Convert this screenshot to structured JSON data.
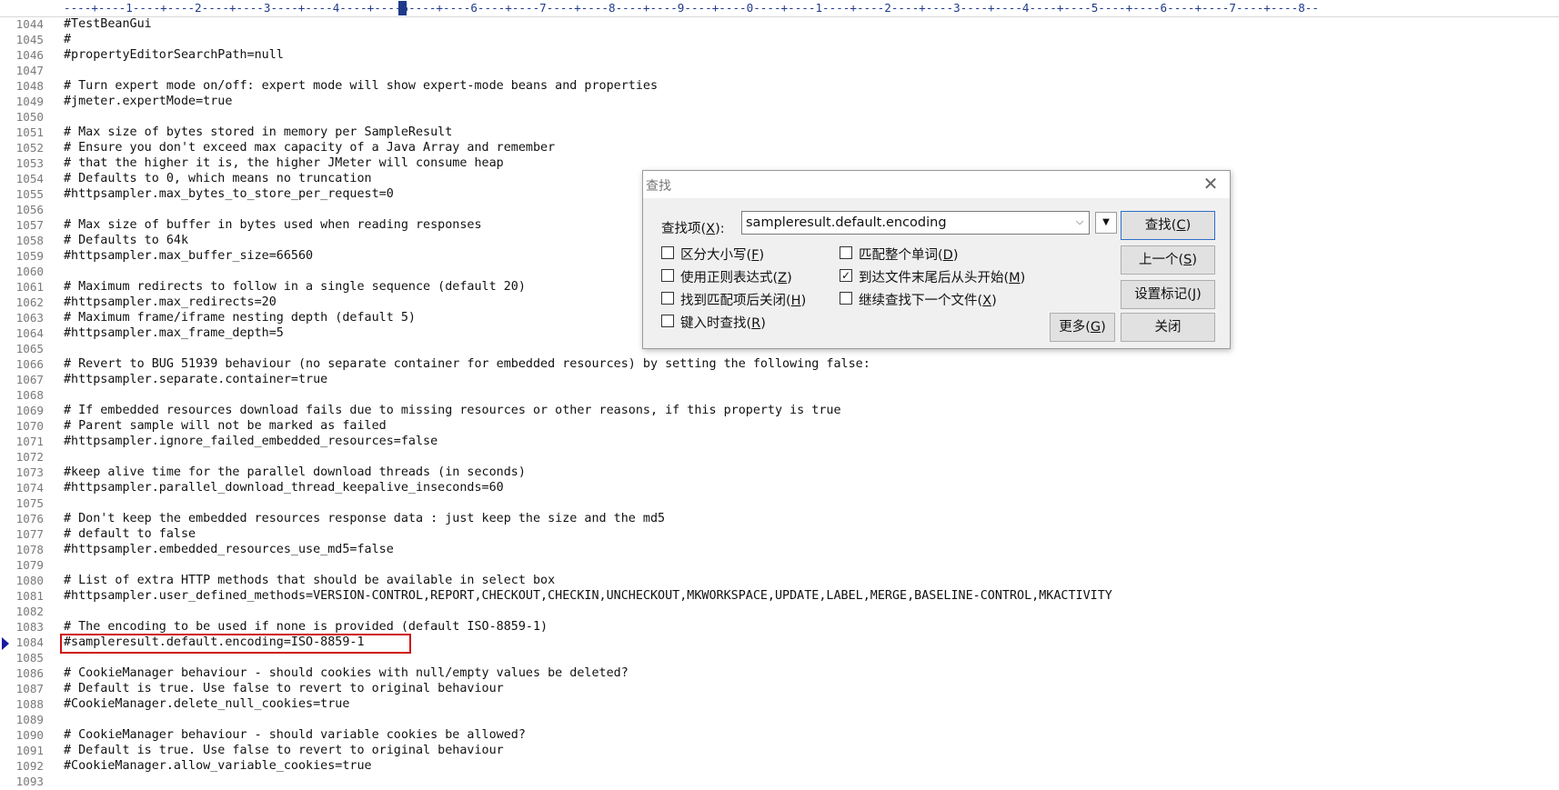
{
  "ruler": {
    "text": "----+----1----+----2----+----3----+----4----+----5----+----6----+----7----+----8----+----9----+----0----+----1----+----2----+----3----+----4----+----5----+----6----+----7----+----8--"
  },
  "editor": {
    "lines": [
      {
        "num": "1044",
        "text": "#TestBeanGui"
      },
      {
        "num": "1045",
        "text": "#"
      },
      {
        "num": "1046",
        "text": "#propertyEditorSearchPath=null"
      },
      {
        "num": "1047",
        "text": ""
      },
      {
        "num": "1048",
        "text": "# Turn expert mode on/off: expert mode will show expert-mode beans and properties"
      },
      {
        "num": "1049",
        "text": "#jmeter.expertMode=true"
      },
      {
        "num": "1050",
        "text": ""
      },
      {
        "num": "1051",
        "text": "# Max size of bytes stored in memory per SampleResult"
      },
      {
        "num": "1052",
        "text": "# Ensure you don't exceed max capacity of a Java Array and remember"
      },
      {
        "num": "1053",
        "text": "# that the higher it is, the higher JMeter will consume heap"
      },
      {
        "num": "1054",
        "text": "# Defaults to 0, which means no truncation"
      },
      {
        "num": "1055",
        "text": "#httpsampler.max_bytes_to_store_per_request=0"
      },
      {
        "num": "1056",
        "text": ""
      },
      {
        "num": "1057",
        "text": "# Max size of buffer in bytes used when reading responses"
      },
      {
        "num": "1058",
        "text": "# Defaults to 64k"
      },
      {
        "num": "1059",
        "text": "#httpsampler.max_buffer_size=66560"
      },
      {
        "num": "1060",
        "text": ""
      },
      {
        "num": "1061",
        "text": "# Maximum redirects to follow in a single sequence (default 20)"
      },
      {
        "num": "1062",
        "text": "#httpsampler.max_redirects=20"
      },
      {
        "num": "1063",
        "text": "# Maximum frame/iframe nesting depth (default 5)"
      },
      {
        "num": "1064",
        "text": "#httpsampler.max_frame_depth=5"
      },
      {
        "num": "1065",
        "text": ""
      },
      {
        "num": "1066",
        "text": "# Revert to BUG 51939 behaviour (no separate container for embedded resources) by setting the following false:"
      },
      {
        "num": "1067",
        "text": "#httpsampler.separate.container=true"
      },
      {
        "num": "1068",
        "text": ""
      },
      {
        "num": "1069",
        "text": "# If embedded resources download fails due to missing resources or other reasons, if this property is true"
      },
      {
        "num": "1070",
        "text": "# Parent sample will not be marked as failed"
      },
      {
        "num": "1071",
        "text": "#httpsampler.ignore_failed_embedded_resources=false"
      },
      {
        "num": "1072",
        "text": ""
      },
      {
        "num": "1073",
        "text": "#keep alive time for the parallel download threads (in seconds)"
      },
      {
        "num": "1074",
        "text": "#httpsampler.parallel_download_thread_keepalive_inseconds=60"
      },
      {
        "num": "1075",
        "text": ""
      },
      {
        "num": "1076",
        "text": "# Don't keep the embedded resources response data : just keep the size and the md5"
      },
      {
        "num": "1077",
        "text": "# default to false"
      },
      {
        "num": "1078",
        "text": "#httpsampler.embedded_resources_use_md5=false"
      },
      {
        "num": "1079",
        "text": ""
      },
      {
        "num": "1080",
        "text": "# List of extra HTTP methods that should be available in select box"
      },
      {
        "num": "1081",
        "text": "#httpsampler.user_defined_methods=VERSION-CONTROL,REPORT,CHECKOUT,CHECKIN,UNCHECKOUT,MKWORKSPACE,UPDATE,LABEL,MERGE,BASELINE-CONTROL,MKACTIVITY"
      },
      {
        "num": "1082",
        "text": ""
      },
      {
        "num": "1083",
        "text": "# The encoding to be used if none is provided (default ISO-8859-1)"
      },
      {
        "num": "1084",
        "text": "#sampleresult.default.encoding=ISO-8859-1"
      },
      {
        "num": "1085",
        "text": ""
      },
      {
        "num": "1086",
        "text": "# CookieManager behaviour - should cookies with null/empty values be deleted?"
      },
      {
        "num": "1087",
        "text": "# Default is true. Use false to revert to original behaviour"
      },
      {
        "num": "1088",
        "text": "#CookieManager.delete_null_cookies=true"
      },
      {
        "num": "1089",
        "text": ""
      },
      {
        "num": "1090",
        "text": "# CookieManager behaviour - should variable cookies be allowed?"
      },
      {
        "num": "1091",
        "text": "# Default is true. Use false to revert to original behaviour"
      },
      {
        "num": "1092",
        "text": "#CookieManager.allow_variable_cookies=true"
      },
      {
        "num": "1093",
        "text": ""
      }
    ]
  },
  "dialog": {
    "title": "查找",
    "find_label": "查找项(",
    "find_label_key": "X",
    "find_label_end": "):",
    "find_value": "sampleresult.default.encoding",
    "checkboxes": [
      {
        "label": "区分大小写(",
        "key": "F",
        "end": ")",
        "checked": false
      },
      {
        "label": "使用正则表达式(",
        "key": "Z",
        "end": ")",
        "checked": false
      },
      {
        "label": "找到匹配项后关闭(",
        "key": "H",
        "end": ")",
        "checked": false
      },
      {
        "label": "键入时查找(",
        "key": "R",
        "end": ")",
        "checked": false
      },
      {
        "label": "匹配整个单词(",
        "key": "D",
        "end": ")",
        "checked": false
      },
      {
        "label": "到达文件末尾后从头开始(",
        "key": "M",
        "end": ")",
        "checked": true
      },
      {
        "label": "继续查找下一个文件(",
        "key": "X",
        "end": ")",
        "checked": false
      }
    ],
    "buttons": {
      "find": {
        "label": "查找(",
        "key": "C",
        "end": ")"
      },
      "prev": {
        "label": "上一个(",
        "key": "S",
        "end": ")"
      },
      "mark": {
        "label": "设置标记(",
        "key": "J",
        "end": ")"
      },
      "more": {
        "label": "更多(",
        "key": "G",
        "end": ")"
      },
      "close": {
        "label": "关闭"
      }
    },
    "checkmark": "✓",
    "close_glyph": "✕",
    "combo_arrow": "⌵",
    "options_arrow": "▼"
  },
  "colors": {
    "highlight_box": "#d01010",
    "ruler_text": "#1f3a8a",
    "bookmark": "#1a1aa0"
  }
}
